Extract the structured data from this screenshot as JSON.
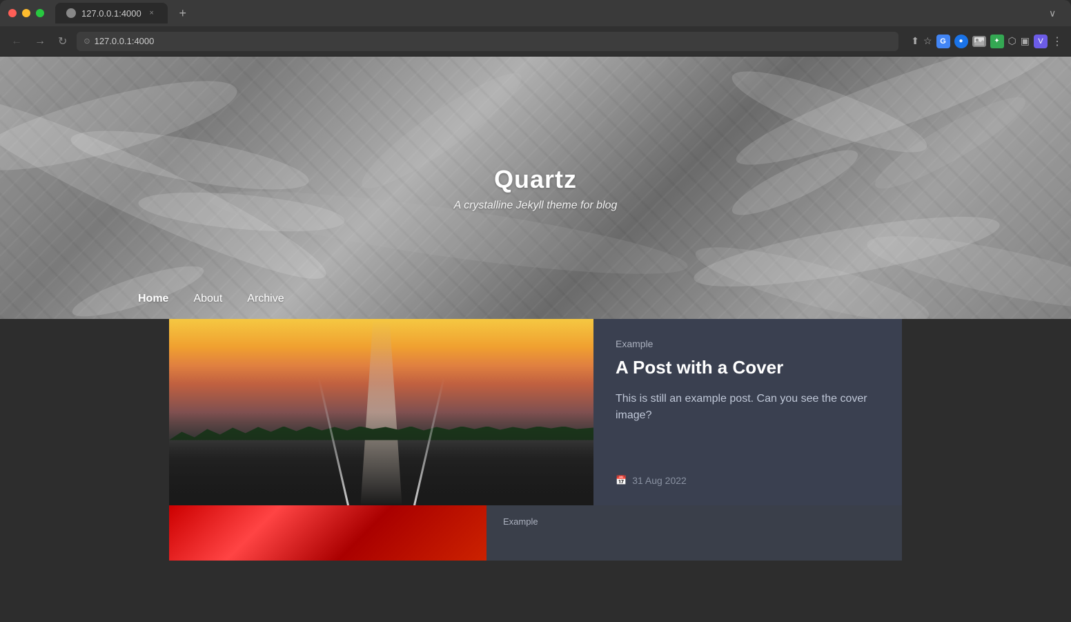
{
  "browser": {
    "url": "127.0.0.1:4000",
    "full_url": "127.0.0.1:4000",
    "tab_title": "127.0.0.1:4000",
    "close_label": "×",
    "add_tab_label": "+"
  },
  "nav": {
    "back_label": "←",
    "forward_label": "→",
    "refresh_label": "↻"
  },
  "site": {
    "title": "Quartz",
    "subtitle": "A crystalline Jekyll theme for blog"
  },
  "navigation": {
    "items": [
      {
        "label": "Home",
        "active": true
      },
      {
        "label": "About",
        "active": false
      },
      {
        "label": "Archive",
        "active": false
      }
    ]
  },
  "post1": {
    "category": "Example",
    "title": "A Post with a Cover",
    "excerpt": "This is still an example post. Can you see the cover image?",
    "date": "31 Aug 2022"
  },
  "post2": {
    "category": "Example"
  }
}
